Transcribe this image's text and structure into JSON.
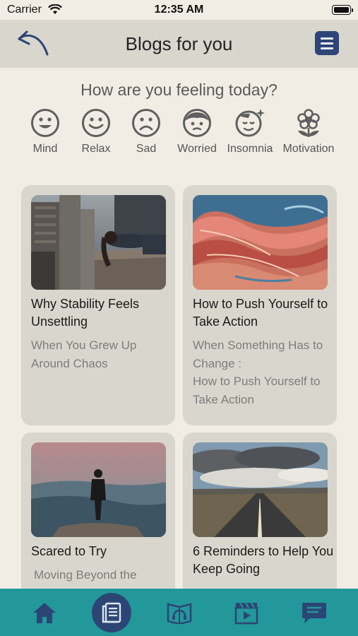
{
  "status_bar": {
    "carrier": "Carrier",
    "time": "12:35 AM"
  },
  "header": {
    "title": "Blogs for you",
    "back_icon": "back-arrow-icon",
    "menu_icon": "hamburger-menu-icon",
    "menu_color": "#2f4579"
  },
  "feelings": {
    "question": "How are you feeling today?",
    "moods": [
      {
        "label": "Mind",
        "icon": "smile-face-icon"
      },
      {
        "label": "Relax",
        "icon": "relax-face-icon"
      },
      {
        "label": "Sad",
        "icon": "sad-face-icon"
      },
      {
        "label": "Worried",
        "icon": "worried-face-icon"
      },
      {
        "label": "Insomnia",
        "icon": "insomnia-face-icon"
      },
      {
        "label": "Motivation",
        "icon": "flower-icon"
      }
    ]
  },
  "blogs": [
    {
      "title": "Why Stability Feels Unsettling",
      "subtitle": "When You Grew Up Around Chaos",
      "image": "woman-on-ledge-city-photo"
    },
    {
      "title": "How to Push Yourself to Take Action",
      "subtitle": "When Something Has to Change :\nHow to Push Yourself to Take Action",
      "image": "abstract-colorful-rock-photo"
    },
    {
      "title": "Scared to Try",
      "subtitle": "Moving Beyond the",
      "image": "man-on-cliff-photo"
    },
    {
      "title": "6 Reminders to Help You Keep Going",
      "subtitle": "",
      "image": "empty-road-clouds-photo"
    }
  ],
  "tabbar": {
    "color": "#23989b",
    "active_color": "#2b4675",
    "tabs": [
      {
        "icon": "home-icon",
        "active": false
      },
      {
        "icon": "blog-book-icon",
        "active": true
      },
      {
        "icon": "audio-book-icon",
        "active": false
      },
      {
        "icon": "video-clapper-icon",
        "active": false
      },
      {
        "icon": "chat-message-icon",
        "active": false
      }
    ]
  }
}
